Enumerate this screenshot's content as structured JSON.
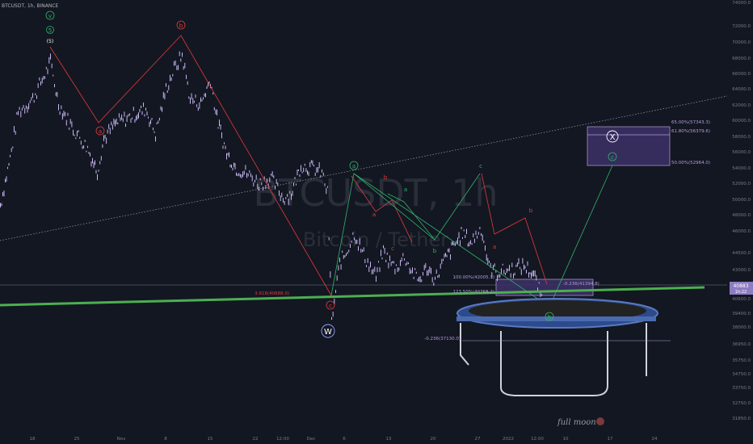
{
  "header": {
    "symbol": "BTCUSDT, 1h, BINANCE"
  },
  "watermark": {
    "ticker": "BTCUSDT, 1h",
    "name": "Bitcoin / Tether"
  },
  "branding": {
    "text": "full moon"
  },
  "price_tag": {
    "value": "40883",
    "sub": "1h:22"
  },
  "colors": {
    "background": "#131722",
    "candles": "#c7b7f0",
    "wave_red": "#e23a3a",
    "wave_green": "#2fb36a",
    "support_line": "#4caf50",
    "box_fill": "#3a3064",
    "text_axis": "#787b86"
  },
  "chart_data": {
    "type": "line",
    "title": "",
    "xlabel": "",
    "ylabel": "",
    "ylim": [
      30500,
      74500
    ],
    "x_ticks": [
      "18",
      "25",
      "Nov",
      "8",
      "15",
      "22",
      "12:00",
      "Dec",
      "6",
      "13",
      "20",
      "27",
      "2022",
      "12:00",
      "10",
      "17",
      "24"
    ],
    "y_ticks": [
      74000,
      72000,
      70000,
      68000,
      66000,
      64000,
      62000,
      60000,
      58000,
      56000,
      54000,
      52000,
      50000,
      48000,
      46000,
      44500,
      43000,
      41500,
      40600,
      39400,
      38000,
      36950,
      35750,
      34750,
      33750,
      32750,
      31850
    ],
    "series": [
      {
        "name": "",
        "points": [
          [
            0,
            53800
          ],
          [
            12,
            58500
          ],
          [
            22,
            63200
          ],
          [
            40,
            64500
          ],
          [
            55,
            67000
          ],
          [
            62,
            68200
          ],
          [
            72,
            64000
          ],
          [
            90,
            61500
          ],
          [
            108,
            59500
          ],
          [
            120,
            57200
          ],
          [
            128,
            60500
          ],
          [
            142,
            62000
          ],
          [
            155,
            62500
          ],
          [
            168,
            63000
          ],
          [
            180,
            63500
          ],
          [
            192,
            61000
          ],
          [
            205,
            65500
          ],
          [
            215,
            67500
          ],
          [
            225,
            68900
          ],
          [
            235,
            64500
          ],
          [
            248,
            64000
          ],
          [
            260,
            66500
          ],
          [
            268,
            62500
          ],
          [
            280,
            59000
          ],
          [
            292,
            57500
          ],
          [
            305,
            57000
          ],
          [
            320,
            56000
          ],
          [
            335,
            56500
          ],
          [
            350,
            54500
          ],
          [
            360,
            55000
          ],
          [
            372,
            57800
          ],
          [
            388,
            57500
          ],
          [
            398,
            57000
          ],
          [
            405,
            55000
          ],
          [
            410,
            42000
          ],
          [
            420,
            48000
          ],
          [
            428,
            49000
          ],
          [
            438,
            51000
          ],
          [
            448,
            49000
          ],
          [
            458,
            47500
          ],
          [
            465,
            46500
          ],
          [
            474,
            49200
          ],
          [
            482,
            48000
          ],
          [
            490,
            47500
          ],
          [
            500,
            48600
          ],
          [
            510,
            47000
          ],
          [
            518,
            46200
          ],
          [
            528,
            47500
          ],
          [
            538,
            46300
          ],
          [
            548,
            48000
          ],
          [
            560,
            49500
          ],
          [
            572,
            51000
          ],
          [
            582,
            50000
          ],
          [
            595,
            51500
          ],
          [
            605,
            47500
          ],
          [
            615,
            47000
          ],
          [
            625,
            47200
          ],
          [
            635,
            47300
          ],
          [
            648,
            47700
          ],
          [
            660,
            46800
          ],
          [
            670,
            44500
          ],
          [
            680,
            42000
          ]
        ]
      }
    ],
    "waves": {
      "red_left": {
        "labels": [
          "(5)",
          "a",
          "b",
          "c"
        ],
        "values": [
          68200,
          57500,
          69000,
          40880
        ]
      },
      "green_right": {
        "labels": [
          "a",
          "b",
          "c",
          "b",
          "X",
          "c"
        ],
        "values": [
          52000,
          46300,
          52000,
          39400,
          56600,
          53400
        ]
      }
    },
    "annotations": [
      {
        "label": "3.618(40688.0)",
        "value": 40688
      },
      {
        "label": "100.00%(42005.3)",
        "value": 42005.3
      },
      {
        "label": "-0.236(41394.8)",
        "value": 41394.8
      },
      {
        "label": "123.50%(40768.2)",
        "value": 40768.2
      },
      {
        "label": "-0.236(37130.0)",
        "value": 37130
      },
      {
        "label": "65.00%(57343.3)",
        "value": 57343.3
      },
      {
        "label": "61.80%(56379.6)",
        "value": 56379.6
      },
      {
        "label": "50.00%(52964.0)",
        "value": 52964
      }
    ],
    "wave_labels_circled": [
      {
        "text": "v",
        "color": "#2fb36a"
      },
      {
        "text": "5",
        "color": "#2fb36a"
      },
      {
        "text": "W",
        "color": "#ffffff"
      }
    ]
  }
}
